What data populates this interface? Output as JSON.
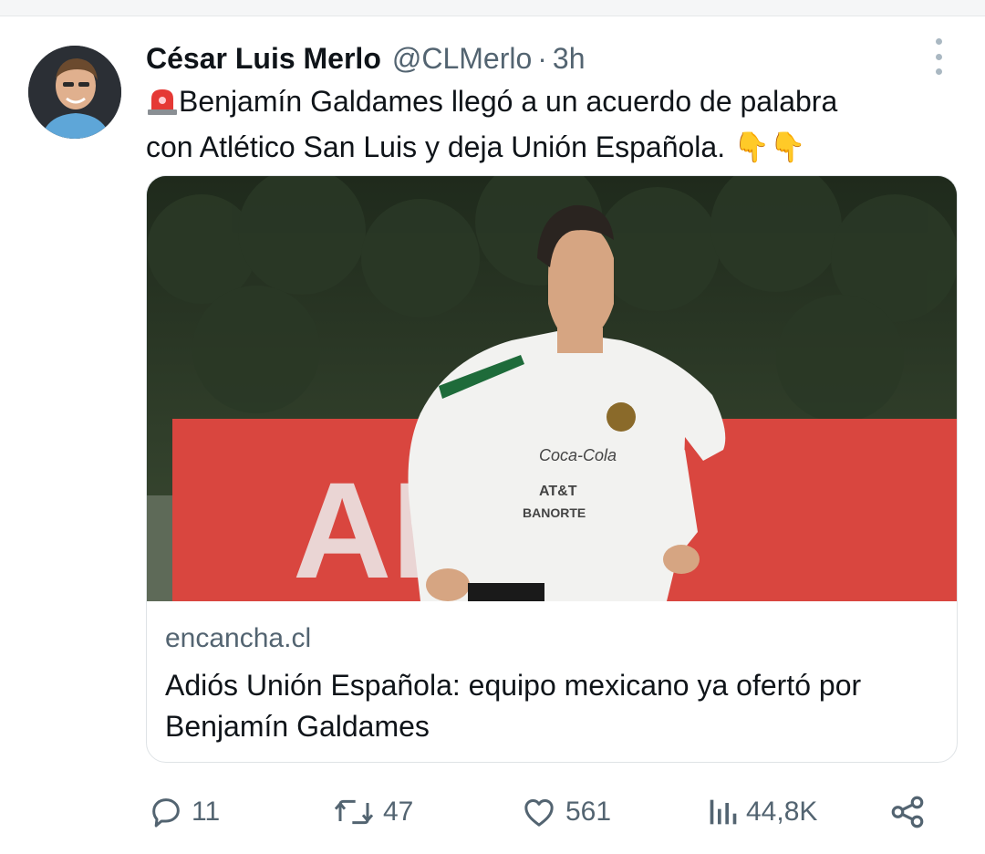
{
  "tweet": {
    "author_name": "César Luis Merlo",
    "author_handle": "@CLMerlo",
    "separator": "·",
    "time": "3h",
    "text_line1": "Benjamín Galdames llegó a un acuerdo de palabra",
    "text_line2": "con Atlético San Luis y deja Unión Española. 👇👇",
    "icons": {
      "leading": "siren-emoji"
    }
  },
  "card": {
    "domain": "encancha.cl",
    "title": "Adiós Unión Española: equipo mexicano ya ofertó por Benjamín Galdames",
    "image": {
      "banner_text": "ANO",
      "jersey_sponsor1": "Coca-Cola",
      "jersey_sponsor2": "AT&T",
      "jersey_sponsor3": "BANORTE"
    }
  },
  "actions": {
    "replies": "11",
    "retweets": "47",
    "likes": "561",
    "views": "44,8K"
  },
  "colors": {
    "text": "#0f1419",
    "muted": "#536471",
    "border": "#dfe3e6"
  }
}
